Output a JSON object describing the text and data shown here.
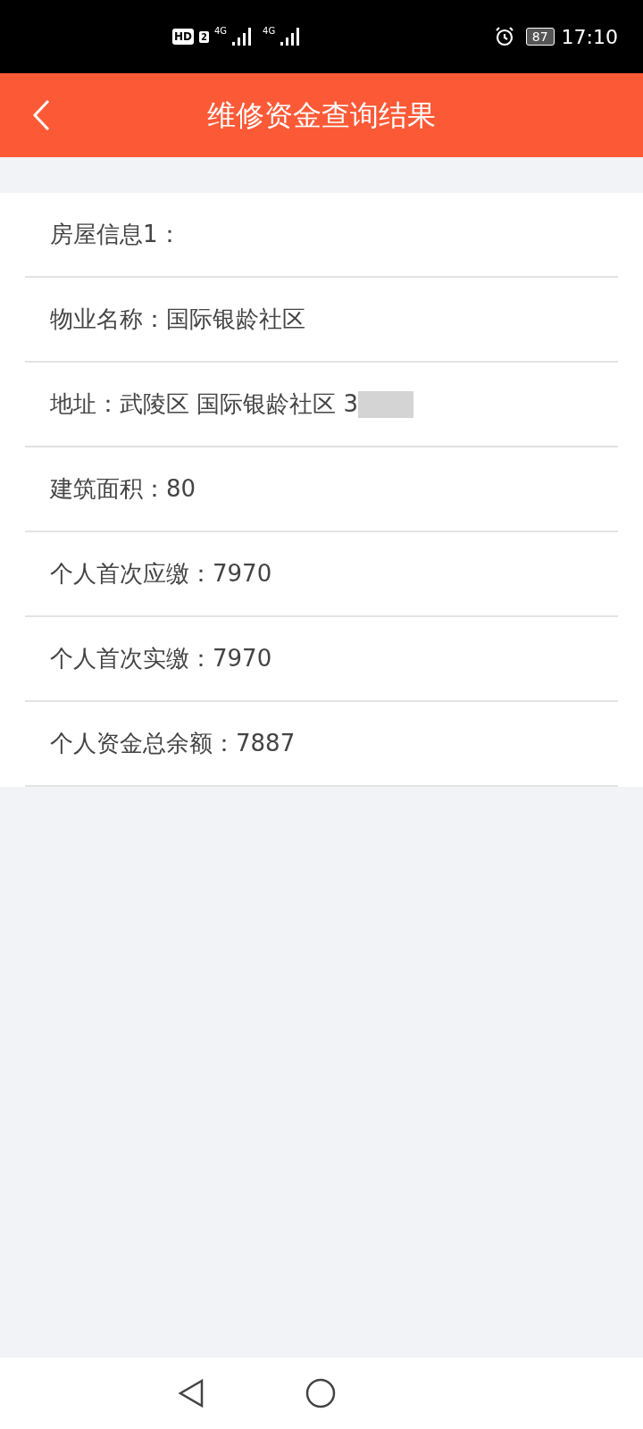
{
  "status_bar": {
    "hd": "HD",
    "sim": "2",
    "network_1": "4G",
    "network_2": "4G",
    "battery": "87",
    "time": "17:10"
  },
  "header": {
    "title": "维修资金查询结果"
  },
  "rows": [
    {
      "text": "房屋信息1："
    },
    {
      "text": "物业名称：国际银龄社区"
    },
    {
      "text": "地址：武陵区 国际银龄社区 3",
      "redacted": true
    },
    {
      "text": "建筑面积：80"
    },
    {
      "text": "个人首次应缴：7970"
    },
    {
      "text": "个人首次实缴：7970"
    },
    {
      "text": "个人资金总余额：7887"
    }
  ]
}
